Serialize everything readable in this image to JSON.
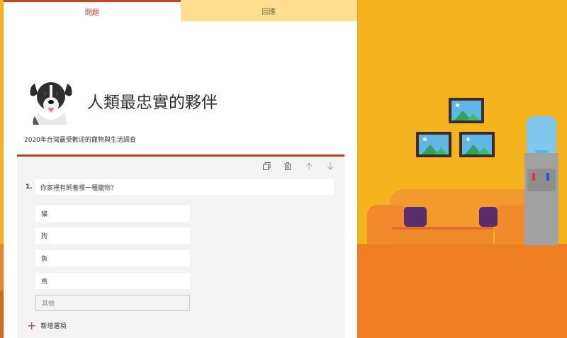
{
  "tabs": {
    "questions": "問題",
    "responses": "回應"
  },
  "form": {
    "title": "人類最忠實的夥伴",
    "subtitle": "2020年台灣最受歡迎的寵物與生活調查"
  },
  "question": {
    "number": "1.",
    "text": "你家裡有飼養哪一種寵物？",
    "options": [
      "貓",
      "狗",
      "魚",
      "鳥"
    ],
    "other_placeholder": "其他",
    "add_option_label": "新增選項"
  },
  "colors": {
    "accent": "#C4451F",
    "tab_inactive": "#FFDF8F",
    "wall": "#F5B31D",
    "floor": "#F08428"
  },
  "icons": {
    "copy": "copy-icon",
    "delete": "trash-icon",
    "move_up": "arrow-up-icon",
    "move_down": "arrow-down-icon",
    "add": "plus-icon"
  }
}
